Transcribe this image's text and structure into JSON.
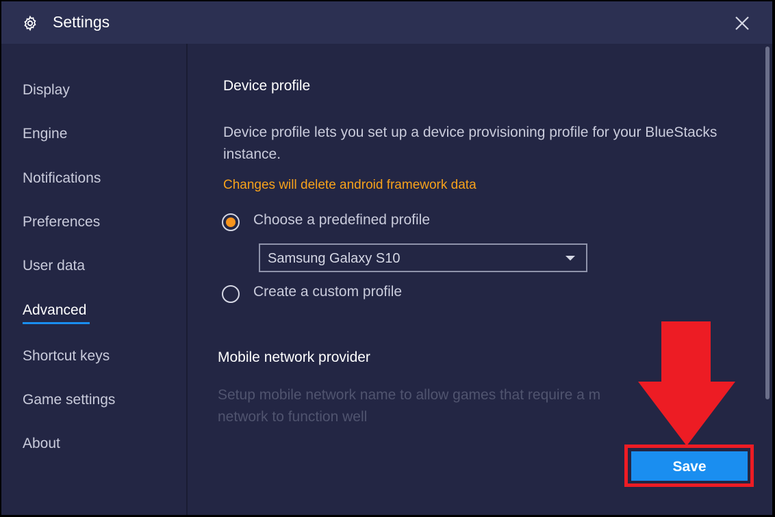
{
  "window": {
    "title": "Settings"
  },
  "sidebar": {
    "items": [
      {
        "label": "Display"
      },
      {
        "label": "Engine"
      },
      {
        "label": "Notifications"
      },
      {
        "label": "Preferences"
      },
      {
        "label": "User data"
      },
      {
        "label": "Advanced",
        "active": true
      },
      {
        "label": "Shortcut keys"
      },
      {
        "label": "Game settings"
      },
      {
        "label": "About"
      }
    ]
  },
  "device_profile": {
    "heading": "Device profile",
    "description": "Device profile lets you set up a device provisioning profile for your BlueStacks instance.",
    "warning": "Changes will delete android framework data",
    "option_predefined": "Choose a predefined profile",
    "option_custom": "Create a custom profile",
    "selected_option": "predefined",
    "selected_profile": "Samsung Galaxy S10"
  },
  "mobile_network": {
    "heading": "Mobile network provider",
    "description_line1": "Setup mobile network name to allow games that require a m",
    "description_line2": "network to function well"
  },
  "footer": {
    "save_label": "Save"
  },
  "colors": {
    "background": "#232644",
    "titlebar": "#2c3052",
    "accent": "#1a8ef0",
    "warning": "#f7a21b",
    "radio_selected": "#f7941d",
    "annotation_red": "#ed1c24"
  },
  "icons": {
    "title": "gear-icon",
    "close": "close-icon",
    "dropdown": "chevron-down-icon",
    "annotation": "arrow-down-icon"
  }
}
